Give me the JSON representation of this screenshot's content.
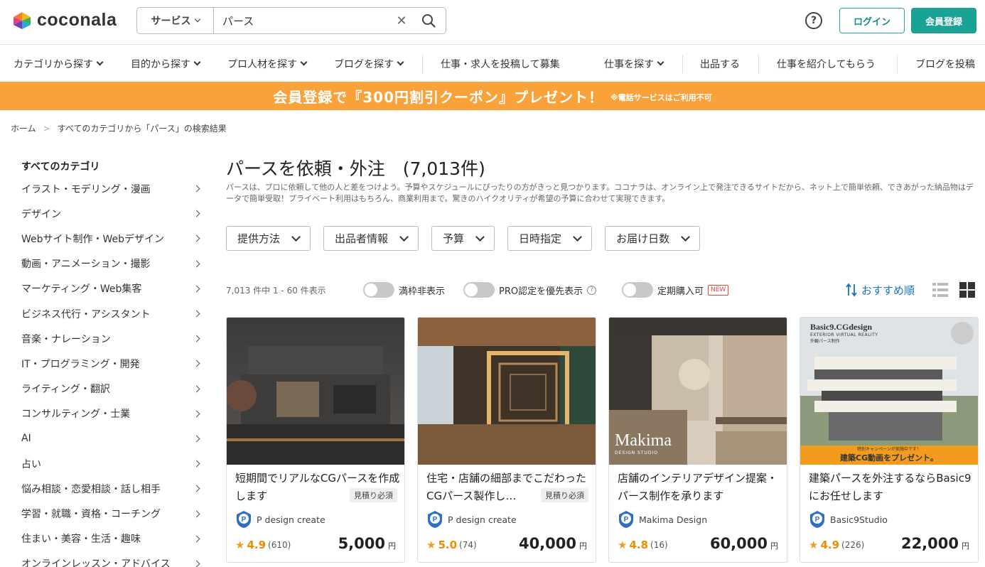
{
  "header": {
    "logo_text": "coconala",
    "search": {
      "category": "サービス",
      "query": "パース"
    },
    "help_glyph": "?",
    "login_label": "ログイン",
    "register_label": "会員登録"
  },
  "nav": {
    "items": [
      "カテゴリから探す",
      "目的から探す",
      "プロ人材を探す",
      "ブログを探す",
      "仕事・求人を投稿して募集",
      "仕事を探す",
      "出品する",
      "仕事を紹介してもらう",
      "ブログを投稿"
    ]
  },
  "banner": {
    "main": "会員登録で『300円割引クーポン』プレゼント！",
    "note": "※電話サービスはご利用不可"
  },
  "breadcrumb": {
    "home": "ホーム",
    "separator": ">",
    "current": "すべてのカテゴリから「パース」の検索結果"
  },
  "sidebar": {
    "heading": "すべてのカテゴリ",
    "items": [
      "イラスト・モデリング・漫画",
      "デザイン",
      "Webサイト制作・Webデザイン",
      "動画・アニメーション・撮影",
      "マーケティング・Web集客",
      "ビジネス代行・アシスタント",
      "音楽・ナレーション",
      "IT・プログラミング・開発",
      "ライティング・翻訳",
      "コンサルティング・士業",
      "AI",
      "占い",
      "悩み相談・恋愛相談・話し相手",
      "学習・就職・資格・コーチング",
      "住まい・美容・生活・趣味",
      "オンラインレッスン・アドバイス"
    ]
  },
  "main": {
    "title": "パースを依頼・外注　(7,013件)",
    "description": "パースは、プロに依頼して他の人と差をつけよう。予算やスケジュールにぴったりの方がきっと見つかります。ココナラは、オンライン上で発注できるサイトだから、ネット上で簡単依頼、できあがった納品物はデータで簡単受取！プライベート利用はもちろん、商業利用まで。驚きのハイクオリティが希望の予算に合わせて実現できます。",
    "filters": [
      "提供方法",
      "出品者情報",
      "予算",
      "日時指定",
      "お届け日数"
    ],
    "result_count": "7,013 件中 1 - 60 件表示",
    "toggles": {
      "full": "満枠非表示",
      "pro": "PRO認定を優先表示",
      "subscription": "定期購入可",
      "new_badge": "NEW",
      "help_glyph": "?"
    },
    "sort_label": "おすすめ順"
  },
  "cards": [
    {
      "title": "短期間でリアルなCGパースを作成します",
      "badge": "見積り必須",
      "seller": "P design create",
      "rating": "4.9",
      "reviews": "(610)",
      "price": "5,000",
      "unit": "円"
    },
    {
      "title": "住宅・店舗の細部までこだわったCGパース製作し…",
      "badge": "見積り必須",
      "seller": "P design create",
      "rating": "5.0",
      "reviews": "(74)",
      "price": "40,000",
      "unit": "円"
    },
    {
      "title": "店舗のインテリアデザイン提案・パース制作を承ります",
      "badge": "",
      "seller": "Makima Design",
      "rating": "4.8",
      "reviews": "(16)",
      "price": "60,000",
      "unit": "円",
      "image_text": "Makima",
      "image_subtext": "DESIGN STUDIO"
    },
    {
      "title": "建築パースを外注するならBasic9にお任せします",
      "badge": "",
      "seller": "Basic9Studio",
      "rating": "4.9",
      "reviews": "(226)",
      "price": "22,000",
      "unit": "円",
      "image_text": "Basic9.CGdesign",
      "image_subtext": "EXTERIOR VIRTUAL REALITY",
      "image_subtext2": "外観パース制作",
      "image_banner_small": "特別キャンペーンが実施中です！",
      "image_banner": "建築CG動画をプレゼント。"
    }
  ]
}
